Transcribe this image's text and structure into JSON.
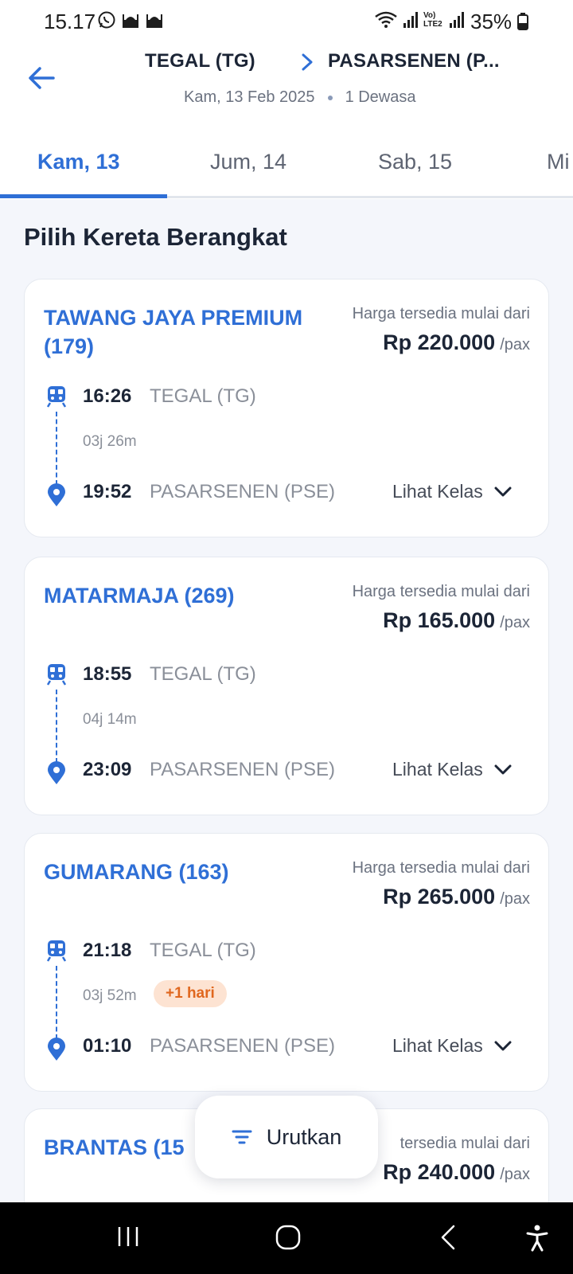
{
  "status_bar": {
    "time": "15.17",
    "battery": "35%",
    "network_label": "Vo) LTE2",
    "icons": [
      "whatsapp-icon",
      "mosque-icon",
      "mosque-icon",
      "wifi-icon",
      "signal-icon",
      "signal-icon",
      "battery-icon"
    ]
  },
  "header": {
    "from": "TEGAL (TG)",
    "to": "PASARSENEN (P...",
    "date": "Kam, 13 Feb 2025",
    "passengers": "1 Dewasa",
    "back_icon": "arrow-left-icon"
  },
  "date_tabs": [
    {
      "label": "Kam, 13",
      "active": true
    },
    {
      "label": "Jum, 14",
      "active": false
    },
    {
      "label": "Sab, 15",
      "active": false
    },
    {
      "label": "Mi",
      "active": false
    }
  ],
  "section_title": "Pilih Kereta Berangkat",
  "trains": [
    {
      "name": "TAWANG JAYA PREMIUM (179)",
      "price_label": "Harga tersedia mulai dari",
      "price": "Rp 220.000",
      "price_unit": "/pax",
      "departure_time": "16:26",
      "departure_station": "TEGAL (TG)",
      "duration": "03j 26m",
      "badge": "",
      "arrival_time": "19:52",
      "arrival_station": "PASARSENEN (PSE)",
      "action": "Lihat Kelas"
    },
    {
      "name": "MATARMAJA (269)",
      "price_label": "Harga tersedia mulai dari",
      "price": "Rp 165.000",
      "price_unit": "/pax",
      "departure_time": "18:55",
      "departure_station": "TEGAL (TG)",
      "duration": "04j 14m",
      "badge": "",
      "arrival_time": "23:09",
      "arrival_station": "PASARSENEN (PSE)",
      "action": "Lihat Kelas"
    },
    {
      "name": "GUMARANG (163)",
      "price_label": "Harga tersedia mulai dari",
      "price": "Rp 265.000",
      "price_unit": "/pax",
      "departure_time": "21:18",
      "departure_station": "TEGAL (TG)",
      "duration": "03j 52m",
      "badge": "+1 hari",
      "arrival_time": "01:10",
      "arrival_station": "PASARSENEN (PSE)",
      "action": "Lihat Kelas"
    },
    {
      "name": "BRANTAS (15",
      "price_label": "tersedia mulai dari",
      "price": "Rp 240.000",
      "price_unit": "/pax"
    }
  ],
  "sort_button": {
    "label": "Urutkan",
    "icon": "filter-icon"
  },
  "nav_bar": {
    "icons": [
      "recent-apps-icon",
      "home-icon",
      "back-icon",
      "accessibility-icon"
    ]
  },
  "colors": {
    "accent": "#2f6fd6",
    "badge_bg": "#fde3d2",
    "badge_text": "#e0671e",
    "page_bg": "#f4f6fb"
  }
}
